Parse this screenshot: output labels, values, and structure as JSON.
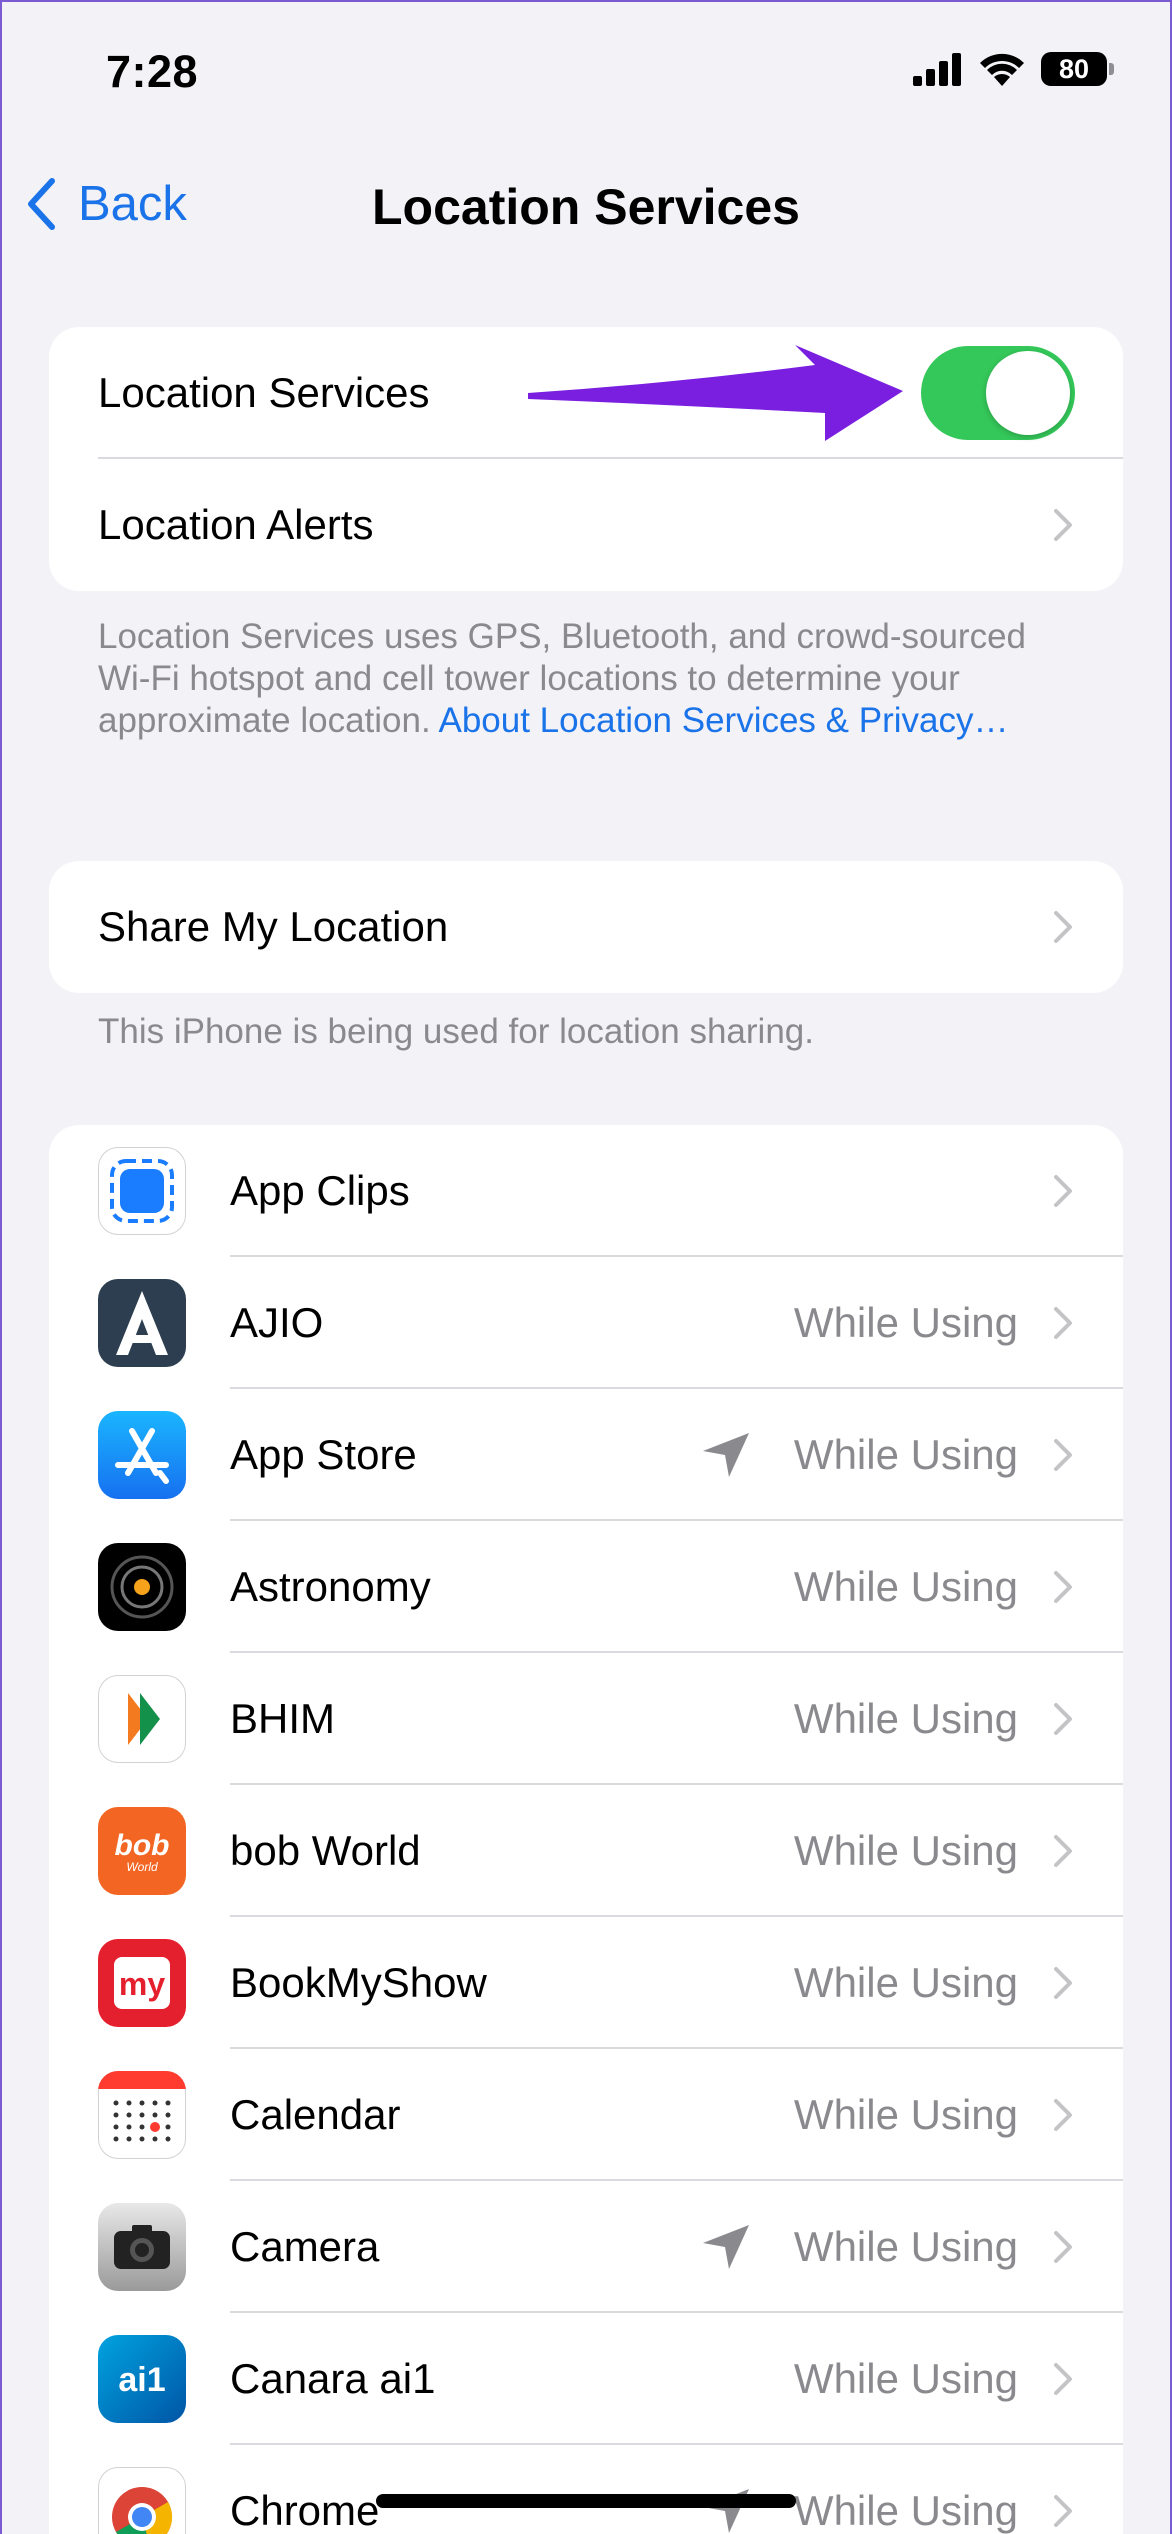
{
  "status_bar": {
    "time": "7:28",
    "battery": "80"
  },
  "nav": {
    "back_label": "Back",
    "title": "Location Services"
  },
  "main_group": {
    "location_services_label": "Location Services",
    "location_services_on": true,
    "location_alerts_label": "Location Alerts"
  },
  "footnote_main": {
    "text": "Location Services uses GPS, Bluetooth, and crowd-sourced Wi-Fi hotspot and cell tower locations to determine your approximate location. ",
    "link": "About Location Services & Privacy…"
  },
  "share": {
    "label": "Share My Location",
    "footnote": "This iPhone is being used for location sharing."
  },
  "apps": [
    {
      "name": "App Clips",
      "value": "",
      "arrow": false,
      "icon": "app-clips"
    },
    {
      "name": "AJIO",
      "value": "While Using",
      "arrow": false,
      "icon": "ajio"
    },
    {
      "name": "App Store",
      "value": "While Using",
      "arrow": true,
      "icon": "app-store"
    },
    {
      "name": "Astronomy",
      "value": "While Using",
      "arrow": false,
      "icon": "astronomy"
    },
    {
      "name": "BHIM",
      "value": "While Using",
      "arrow": false,
      "icon": "bhim"
    },
    {
      "name": "bob World",
      "value": "While Using",
      "arrow": false,
      "icon": "bob-world"
    },
    {
      "name": "BookMyShow",
      "value": "While Using",
      "arrow": false,
      "icon": "bookmyshow"
    },
    {
      "name": "Calendar",
      "value": "While Using",
      "arrow": false,
      "icon": "calendar"
    },
    {
      "name": "Camera",
      "value": "While Using",
      "arrow": true,
      "icon": "camera"
    },
    {
      "name": "Canara ai1",
      "value": "While Using",
      "arrow": false,
      "icon": "canara"
    },
    {
      "name": "Chrome",
      "value": "While Using",
      "arrow": true,
      "icon": "chrome"
    }
  ],
  "icon_text": {
    "bob": "bob",
    "bob_sub": "World",
    "my": "my",
    "ai1": "ai1"
  },
  "colors": {
    "accent": "#1a73e8",
    "toggle_on": "#34c759",
    "annotation_arrow": "#7a1fe0"
  }
}
